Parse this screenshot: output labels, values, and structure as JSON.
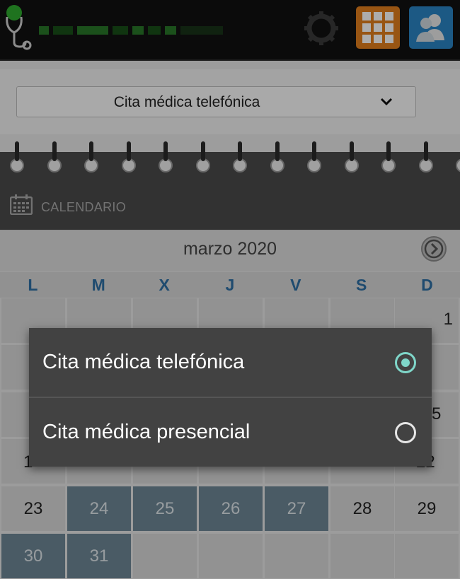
{
  "header": {
    "app_icon": "stethoscope-icon",
    "settings_icon": "gear-icon",
    "apps_icon": "apps-grid-icon",
    "users_icon": "users-icon",
    "colors": {
      "apps": "#e07e1c",
      "users": "#2a84c3",
      "brand": "#2e8a2e"
    }
  },
  "selector": {
    "value": "Cita médica telefónica",
    "icon": "chevron-down-icon"
  },
  "calendar": {
    "section_label": "CALENDARIO",
    "month_title": "marzo 2020",
    "next_icon": "chevron-right-icon",
    "weekdays": [
      "L",
      "M",
      "X",
      "J",
      "V",
      "S",
      "D"
    ],
    "peek_numbers": {
      "r1_d": "1",
      "r3_d": "5",
      "r4_l": "1",
      "r4_d": "22"
    },
    "row5": [
      "23",
      "24",
      "25",
      "26",
      "27",
      "28",
      "29"
    ],
    "row6": [
      "30",
      "31"
    ],
    "accent_color": "#2e6fa4",
    "highlight_color": "#6d8796"
  },
  "dialog": {
    "options": [
      {
        "label": "Cita médica telefónica",
        "selected": true
      },
      {
        "label": "Cita médica presencial",
        "selected": false
      }
    ],
    "radio_color": "#7fd6c9"
  }
}
